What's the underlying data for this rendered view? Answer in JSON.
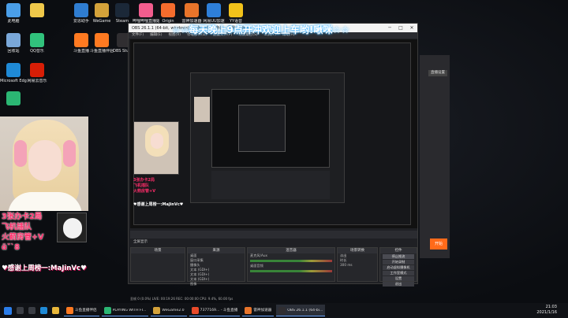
{
  "desktop_icons": [
    {
      "label": "此电脑",
      "color": "#4a9ee8"
    },
    {
      "label": "",
      "color": "#f0c84a"
    },
    {
      "label": "爱思助手",
      "color": "#2f7dd1"
    },
    {
      "label": "WeGame",
      "color": "#d4a23a"
    },
    {
      "label": "Steam",
      "color": "#1b2838"
    },
    {
      "label": "哔哩哔哩直播姬",
      "color": "#f25d8e"
    },
    {
      "label": "Origin",
      "color": "#f56c2d"
    },
    {
      "label": "雷神加速器",
      "color": "#e8742a"
    },
    {
      "label": "网易UU加速",
      "color": "#2e7fd9"
    },
    {
      "label": "YY语音",
      "color": "#f2c21a"
    },
    {
      "label": "回收站",
      "color": "#7aa8d9"
    },
    {
      "label": "QQ音乐",
      "color": "#31c27c"
    },
    {
      "label": "斗鱼直播",
      "color": "#ff7a21"
    },
    {
      "label": "斗鱼直播伴侣",
      "color": "#ff7a21"
    },
    {
      "label": "OBS Studio",
      "color": "#302e31"
    },
    {
      "label": "Microsoft Edge",
      "color": "#1f8ad6"
    },
    {
      "label": "网易云音乐",
      "color": "#d81e06"
    },
    {
      "label": "",
      "color": "#2bb673"
    }
  ],
  "overlay": {
    "banner": "☆☆每天晚上9点开冲欢迎上车哟!啾咪☆☆",
    "line1": "3张办卡2局",
    "line2": "飞机插队",
    "line3": "火箭房管+V",
    "line4": "ɑ̃ˇˋ8",
    "thanks": "♥感谢上周榜一:MaJinVc♥"
  },
  "obs": {
    "title": "OBS 26.1.1 (64-bit, windows) - 配置文件: 未命名 - 场景: 未命名",
    "menu": [
      "文件(F)",
      "编辑(E)",
      "视图(V)",
      "停靠部件(D)",
      "配置文件(P)",
      "场景集合(S)",
      "工具(T)",
      "帮助(H)"
    ],
    "source_bar": "全屏显示",
    "docks": {
      "scenes": "场景",
      "sources": "来源",
      "sources_items": [
        "桌面",
        "窗口采集",
        "摄像头",
        "文本 (GDI+)",
        "文本 (GDI+)",
        "文本 (GDI+)",
        "图像"
      ],
      "audio": "混音器",
      "audio_items": [
        "麦克风/Aux",
        "0.0 dB",
        "桌面音频",
        "0.0 dB"
      ],
      "transitions": "场景转换",
      "transition_value": "淡出",
      "duration_label": "时长",
      "duration_value": "300 ms",
      "controls": "控件",
      "controls_items": [
        "停止推流",
        "开始录制",
        "启动虚拟摄像机",
        "工作室模式",
        "设置",
        "退出"
      ]
    },
    "status": "丢帧 0 (0.0%)   LIVE: 00:19:26   REC: 00:00:00   CPU: 9.4%, 60.00 fps"
  },
  "side_window": {
    "tag": "直播设置",
    "button": "开始"
  },
  "taskbar": {
    "apps": [
      {
        "label": "斗鱼直播伴侣",
        "color": "#ff7a21"
      },
      {
        "label": "PLAYING WITH FI...",
        "color": "#2bb673"
      },
      {
        "label": "WeGame2.0",
        "color": "#d4a23a"
      },
      {
        "label": "7377169... - 斗鱼直播",
        "color": "#e84a2a"
      },
      {
        "label": "雷神加速器",
        "color": "#e8742a"
      },
      {
        "label": "OBS 26.1.1 (64-bi...",
        "color": "#302e31"
      }
    ],
    "time": "21:03",
    "date": "2021/1/16"
  }
}
